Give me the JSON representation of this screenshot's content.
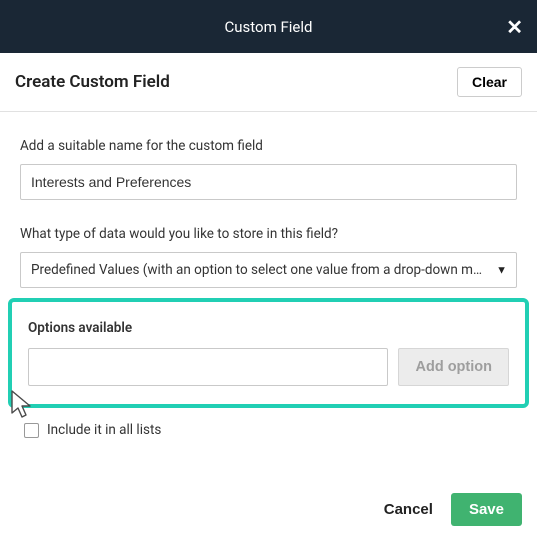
{
  "modal": {
    "title": "Custom Field",
    "close_glyph": "✕"
  },
  "header": {
    "title": "Create Custom Field",
    "clear_label": "Clear"
  },
  "form": {
    "name_label": "Add a suitable name for the custom field",
    "name_value": "Interests and Preferences",
    "type_label": "What type of data would you like to store in this field?",
    "type_selected": "Predefined Values (with an option to select one value from a drop-down menu)",
    "options_title": "Options available",
    "option_input_value": "",
    "add_option_label": "Add option",
    "include_all_label": "Include it in all lists",
    "include_all_checked": false
  },
  "footer": {
    "cancel_label": "Cancel",
    "save_label": "Save"
  }
}
